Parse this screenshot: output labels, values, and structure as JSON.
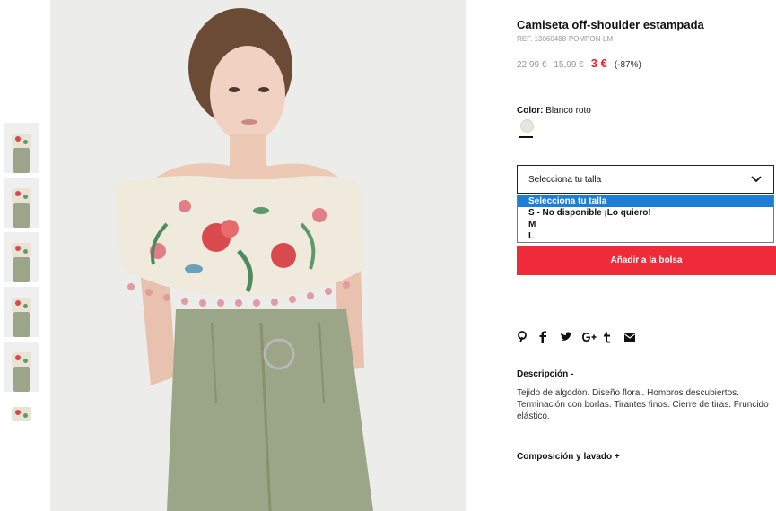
{
  "product": {
    "title": "Camiseta off-shoulder estampada",
    "ref": "REF. 13060488-POMPON-LM",
    "price_old_1": "22,99 €",
    "price_old_2": "15,99 €",
    "price_new": "3 €",
    "discount": "(-87%)"
  },
  "color": {
    "label": "Color:",
    "value": "Blanco roto",
    "swatch_hex": "#e8e6dc"
  },
  "size_select": {
    "current": "Selecciona tu talla",
    "options": [
      "Selecciona tu talla",
      "S - No disponible ¡Lo quiero!",
      "M",
      "L"
    ]
  },
  "add_to_bag": "Añadir a la bolsa",
  "social_icons": [
    "pinterest-icon",
    "facebook-icon",
    "twitter-icon",
    "google-plus-icon",
    "tumblr-icon",
    "mail-icon"
  ],
  "description": {
    "heading": "Descripción -",
    "text": "Tejido de algodón. Diseño floral. Hombros descubiertos. Terminación con borlas. Tirantes finos. Cierre de tiras. Fruncido elástico."
  },
  "composition_heading": "Composición y lavado +",
  "colors": {
    "accent_red": "#ef2b3a",
    "price_red": "#e2232b",
    "select_highlight": "#1e7ed6"
  }
}
